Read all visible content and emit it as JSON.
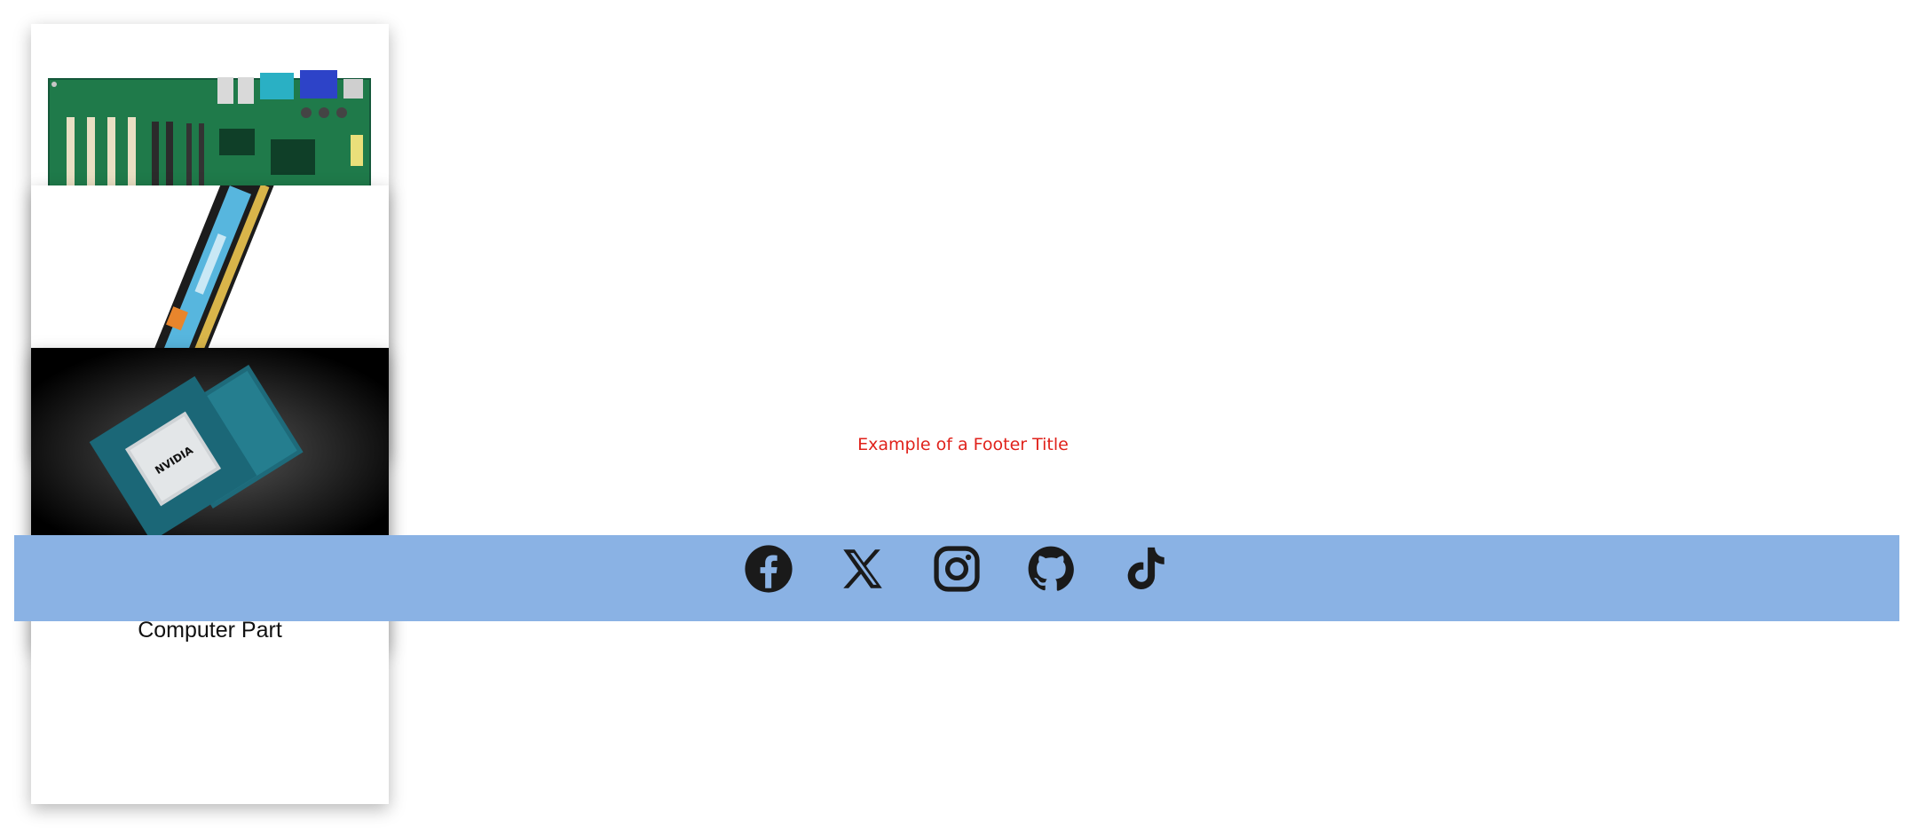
{
  "cards": [
    {
      "image": "motherboard",
      "caption": ""
    },
    {
      "image": "ram-module",
      "caption": ""
    },
    {
      "image": "nvidia-gpu-chip",
      "caption": "Computer Part"
    }
  ],
  "footer": {
    "title": "Example of a Footer Title",
    "title_color": "#e0221b",
    "bar_color": "#8ab2e4",
    "icon_color": "#1a1a1a",
    "social_icons": [
      "facebook-icon",
      "x-icon",
      "instagram-icon",
      "github-icon",
      "tiktok-icon"
    ]
  }
}
